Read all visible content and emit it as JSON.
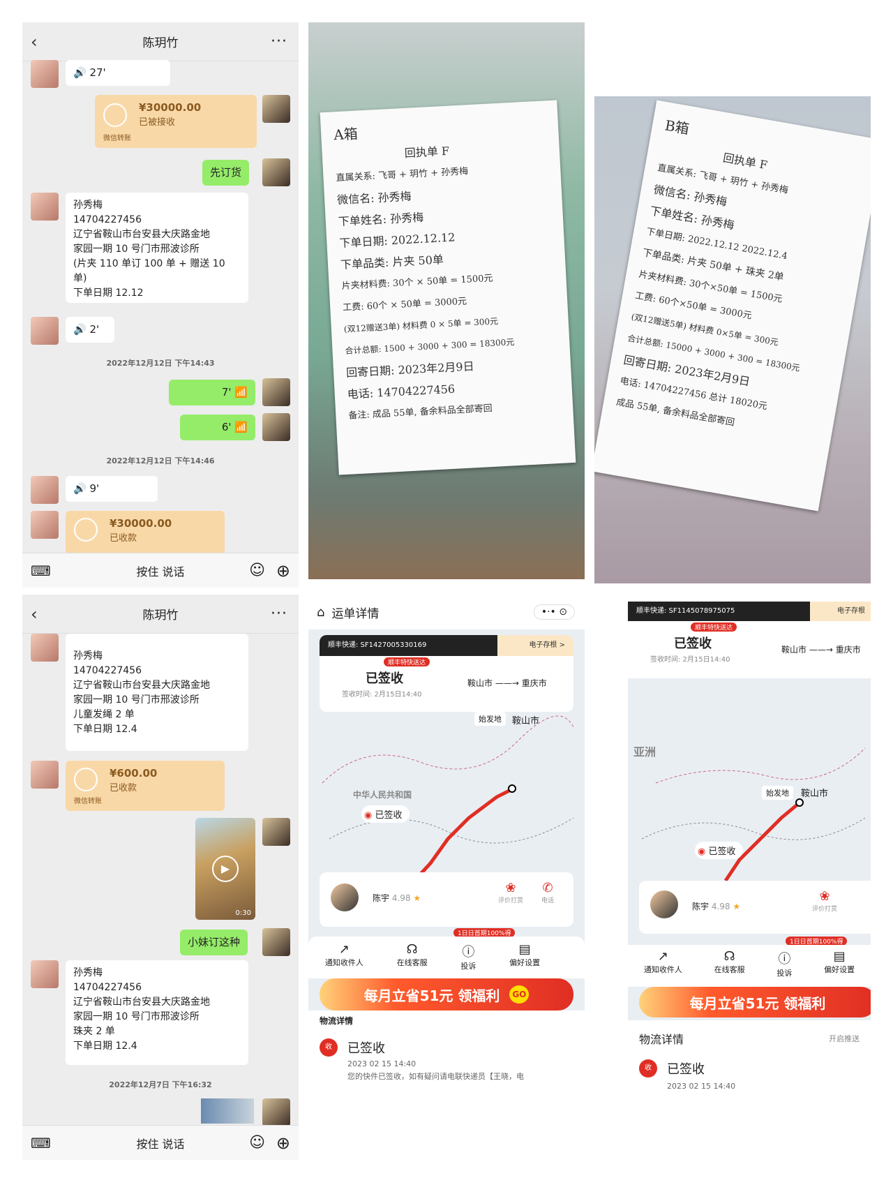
{
  "chat1": {
    "title": "陈玥竹",
    "voice1": "27'",
    "transfer1_amount": "¥30000.00",
    "transfer1_status": "已被接收",
    "transfer1_note": "微信转账",
    "msg_first_order": "先订货",
    "order1": [
      "孙秀梅",
      "14704227456",
      "辽宁省鞍山市台安县大庆路金地",
      "家园一期 10 号门市邢波诊所",
      "(片夹 110 单订 100 单 + 赠送 10",
      "单)",
      "下单日期 12.12"
    ],
    "voice2": "2'",
    "time1": "2022年12月12日 下午14:43",
    "voice3": "7'",
    "voice4": "6'",
    "time2": "2022年12月12日 下午14:46",
    "voice5": "9'",
    "transfer2_amount": "¥30000.00",
    "transfer2_status": "已收款",
    "footer_talk": "按住 说话"
  },
  "note_a": {
    "lines": [
      "A箱",
      "回执单 F",
      "直属关系: 飞哥 + 玥竹 + 孙秀梅",
      "微信名: 孙秀梅",
      "下单姓名: 孙秀梅",
      "下单日期: 2022.12.12",
      "下单品类: 片夹 50单",
      "片夹材料费: 30个 × 50单 = 1500元",
      "工费: 60个 × 50单 = 3000元",
      "(双12赠送3单) 材料费 0 × 5单 = 300元",
      "合计总额: 1500 + 3000 + 300 = 18300元",
      "回寄日期: 2023年2月9日",
      "电话: 14704227456",
      "备注: 成品 55单, 备余料品全部寄回"
    ]
  },
  "note_b": {
    "lines": [
      "B箱",
      "回执单 F",
      "直属关系: 飞哥 + 玥竹 + 孙秀梅",
      "微信名: 孙秀梅",
      "下单姓名: 孙秀梅",
      "下单日期: 2022.12.12   2022.12.4",
      "下单品类: 片夹 50单 + 珠夹 2单",
      "片夹材料费: 30个×50单 = 1500元",
      "工费: 60个×50单 = 3000元",
      "(双12赠送5单) 材料费 0×5单 = 300元",
      "合计总额: 15000 + 3000 + 300 = 18300元",
      "回寄日期: 2023年2月9日",
      "电话: 14704227456   总计 18020元",
      "成品 55单, 备余料品全部寄回"
    ]
  },
  "chat2": {
    "title": "陈玥竹",
    "order2": [
      "孙秀梅",
      "14704227456",
      "辽宁省鞍山市台安县大庆路金地",
      "家园一期 10 号门市邢波诊所",
      "儿童发绳 2 单",
      "下单日期 12.4"
    ],
    "transfer3_amount": "¥600.00",
    "transfer3_status": "已收款",
    "transfer3_note": "微信转账",
    "video_dur": "0:30",
    "msg_style": "小妹订这种",
    "order3": [
      "孙秀梅",
      "14704227456",
      "辽宁省鞍山市台安县大庆路金地",
      "家园一期 10 号门市邢波诊所",
      "珠夹 2 单",
      "下单日期 12.4"
    ],
    "time3": "2022年12月7日 下午16:32",
    "footer_talk": "按住 说话"
  },
  "track1": {
    "title": "运单详情",
    "waybill": "顺丰快递: SF1427005330169",
    "e_receipt": "电子存根 >",
    "tag": "顺丰特快送达",
    "status": "已签收",
    "sign_time": "签收时间: 2月15日14:40",
    "from": "鞍山市",
    "to": "重庆市",
    "start_label": "始发地",
    "start_city": "鞍山市",
    "map_label": "中华人民共和国",
    "signed_label": "已签收",
    "courier": "陈宇",
    "rating": "4.98",
    "act1": "评价打赏",
    "act2": "电话",
    "promo_tag": "1日日首期100%得",
    "menu": [
      "通知收件人",
      "在线客服",
      "投诉",
      "偏好设置"
    ],
    "banner": "每月立省51元 领福利",
    "go": "GO",
    "logistics": "物流详情",
    "signed": "已签收",
    "signed_time": "2023 02 15 14:40",
    "signed_desc": "您的快件已签收，如有疑问请电联快递员【王晓，电"
  },
  "track2": {
    "waybill": "顺丰快递: SF1145078975075",
    "e_receipt": "电子存根",
    "tag": "顺丰特快送达",
    "status": "已签收",
    "sign_time": "签收时间: 2月15日14:40",
    "from": "鞍山市",
    "to": "重庆市",
    "region": "亚洲",
    "start_label": "始发地",
    "start_city": "鞍山市",
    "signed_label": "已签收",
    "courier": "陈宇",
    "rating": "4.98",
    "act1": "评价打赏",
    "promo_tag": "1日日首期100%得",
    "menu": [
      "通知收件人",
      "在线客服",
      "投诉",
      "偏好设置"
    ],
    "banner": "每月立省51元 领福利",
    "logistics": "物流详情",
    "open_push": "开启推送",
    "signed": "已签收",
    "signed_time": "2023 02 15 14:40"
  }
}
